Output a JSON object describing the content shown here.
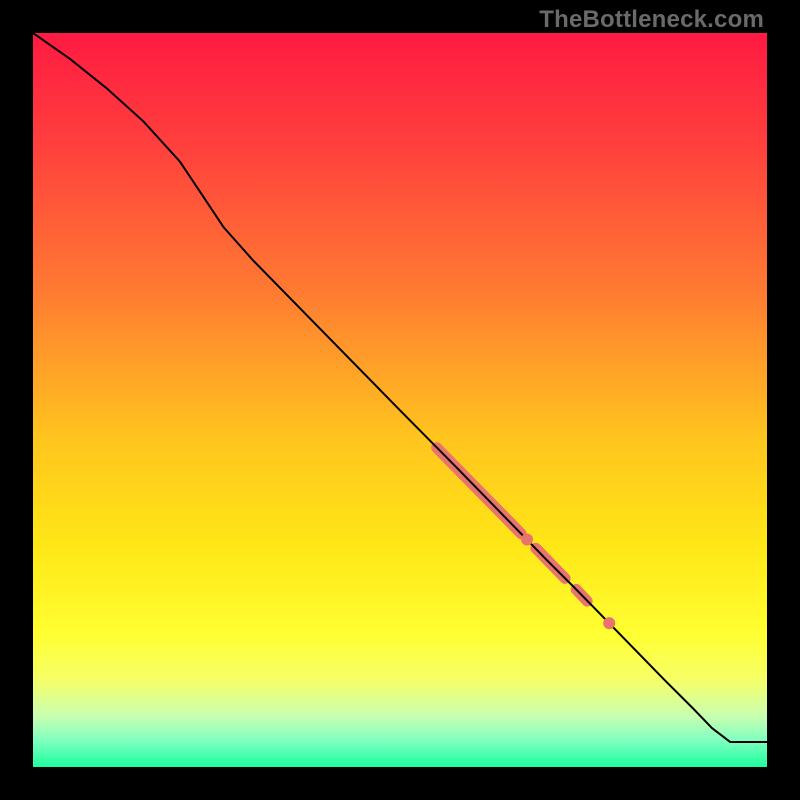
{
  "watermark": "TheBottleneck.com",
  "chart_data": {
    "type": "line",
    "title": "",
    "xlabel": "",
    "ylabel": "",
    "xlim": [
      0,
      100
    ],
    "ylim": [
      0,
      100
    ],
    "grid": false,
    "legend": false,
    "background_gradient_stops": [
      {
        "offset": 0.0,
        "color": "#ff1a42"
      },
      {
        "offset": 0.15,
        "color": "#ff3f3d"
      },
      {
        "offset": 0.35,
        "color": "#ff7a32"
      },
      {
        "offset": 0.55,
        "color": "#ffc41e"
      },
      {
        "offset": 0.7,
        "color": "#ffe716"
      },
      {
        "offset": 0.82,
        "color": "#ffff33"
      },
      {
        "offset": 0.88,
        "color": "#f7ff66"
      },
      {
        "offset": 0.93,
        "color": "#c9ffb0"
      },
      {
        "offset": 0.965,
        "color": "#7dffc0"
      },
      {
        "offset": 1.0,
        "color": "#1bff9e"
      }
    ],
    "series": [
      {
        "name": "curve",
        "color": "#000000",
        "stroke_width": 2,
        "x": [
          0,
          5,
          10,
          15,
          20,
          23,
          26,
          30,
          40,
          50,
          58,
          62,
          66,
          70,
          74,
          78,
          82,
          86,
          90,
          92.5,
          95,
          100
        ],
        "y": [
          100,
          96.5,
          92.5,
          88,
          82.5,
          78,
          73.5,
          69,
          58.8,
          48.6,
          40.5,
          36.4,
          32.3,
          28.2,
          24.2,
          20.1,
          16.0,
          11.9,
          7.9,
          5.3,
          3.4,
          3.4
        ]
      }
    ],
    "highlight_segments": [
      {
        "name": "band-1",
        "color": "#e9746d",
        "width": 11,
        "x": [
          55.0,
          66.5
        ],
        "y": [
          43.5,
          31.8
        ]
      },
      {
        "name": "band-2",
        "color": "#e9746d",
        "width": 11,
        "x": [
          68.5,
          72.5
        ],
        "y": [
          29.8,
          25.7
        ]
      },
      {
        "name": "band-3",
        "color": "#e9746d",
        "width": 11,
        "x": [
          74.0,
          75.5
        ],
        "y": [
          24.2,
          22.6
        ]
      }
    ],
    "highlight_points": [
      {
        "name": "dot-1",
        "color": "#e9746d",
        "r": 6,
        "x": 67.3,
        "y": 31.0
      },
      {
        "name": "dot-2",
        "color": "#e9746d",
        "r": 6,
        "x": 78.5,
        "y": 19.6
      }
    ]
  }
}
